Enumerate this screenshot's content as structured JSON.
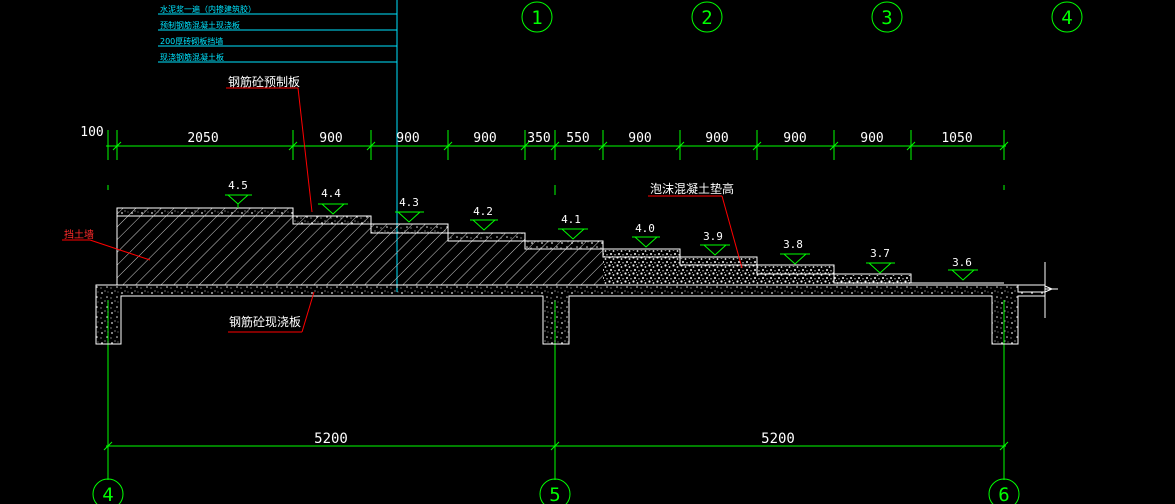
{
  "colors": {
    "background": "#000000",
    "dimension": "#00ff00",
    "axis_circle": "#00ff00",
    "structure": "#ffffff",
    "hatch": "#d4d4d4",
    "leader_cyan": "#00e5ff",
    "leader_red": "#ff0000",
    "note_red": "#ff2a2a",
    "text_main": "#ffffff",
    "text_cyan": "#00e5ff"
  },
  "layer_notes": [
    "水泥浆一遍（内掺建筑胶）",
    "预制钢筋混凝土现浇板",
    "200厚砖砌板挡墙",
    "现浇钢筋混凝土板"
  ],
  "top_axes": [
    "1",
    "2",
    "3",
    "4"
  ],
  "bottom_axes": [
    "4",
    "5",
    "6"
  ],
  "top_dim_prefix": "100",
  "top_dims": [
    "2050",
    "900",
    "900",
    "900",
    "350",
    "550",
    "900",
    "900",
    "900",
    "900",
    "1050"
  ],
  "bottom_dims": [
    "5200",
    "5200"
  ],
  "step_elevations": [
    "4.5",
    "4.4",
    "4.3",
    "4.2",
    "4.1",
    "4.0",
    "3.9",
    "3.8",
    "3.7",
    "3.6"
  ],
  "labels": {
    "precast_slab": "钢筋砼预制板",
    "cast_in_place_slab": "钢筋砼现浇板",
    "foam_concrete": "泡沫混凝土垫高",
    "side_wall": "挡土墙"
  }
}
